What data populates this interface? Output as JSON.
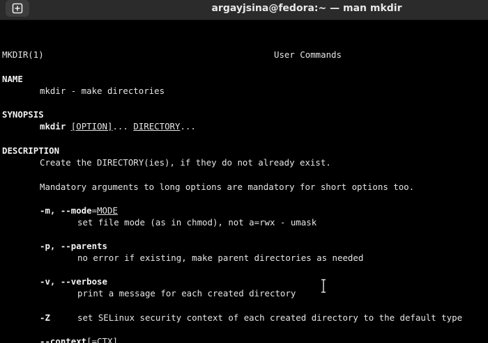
{
  "window": {
    "title": "argayjsina@fedora:~ — man mkdir",
    "new_tab_icon": "plus-square-icon"
  },
  "man": {
    "header_left": "MKDIR(1)",
    "header_center": "User Commands",
    "name_heading": "NAME",
    "name_text": "mkdir - make directories",
    "synopsis_heading": "SYNOPSIS",
    "synopsis_cmd": "mkdir",
    "synopsis_option": "[OPTION]",
    "synopsis_ellipsis": "...",
    "synopsis_directory": "DIRECTORY",
    "synopsis_end": "...",
    "description_heading": "DESCRIPTION",
    "desc_line1": "Create the DIRECTORY(ies), if they do not already exist.",
    "desc_line2": "Mandatory arguments to long options are mandatory for short options too.",
    "opt_m_flag": "-m, --mode",
    "opt_m_eq": "=",
    "opt_m_arg": "MODE",
    "opt_m_desc": "set file mode (as in chmod), not a=rwx - umask",
    "opt_p_flag": "-p, --parents",
    "opt_p_desc": "no error if existing, make parent directories as needed",
    "opt_v_flag": "-v, --verbose",
    "opt_v_desc": "print a message for each created directory",
    "opt_z_flag": "-Z",
    "opt_z_desc": "set SELinux security context of each created directory to the default type",
    "opt_context_flag": "--context",
    "opt_context_arg": "[=CTX]"
  }
}
